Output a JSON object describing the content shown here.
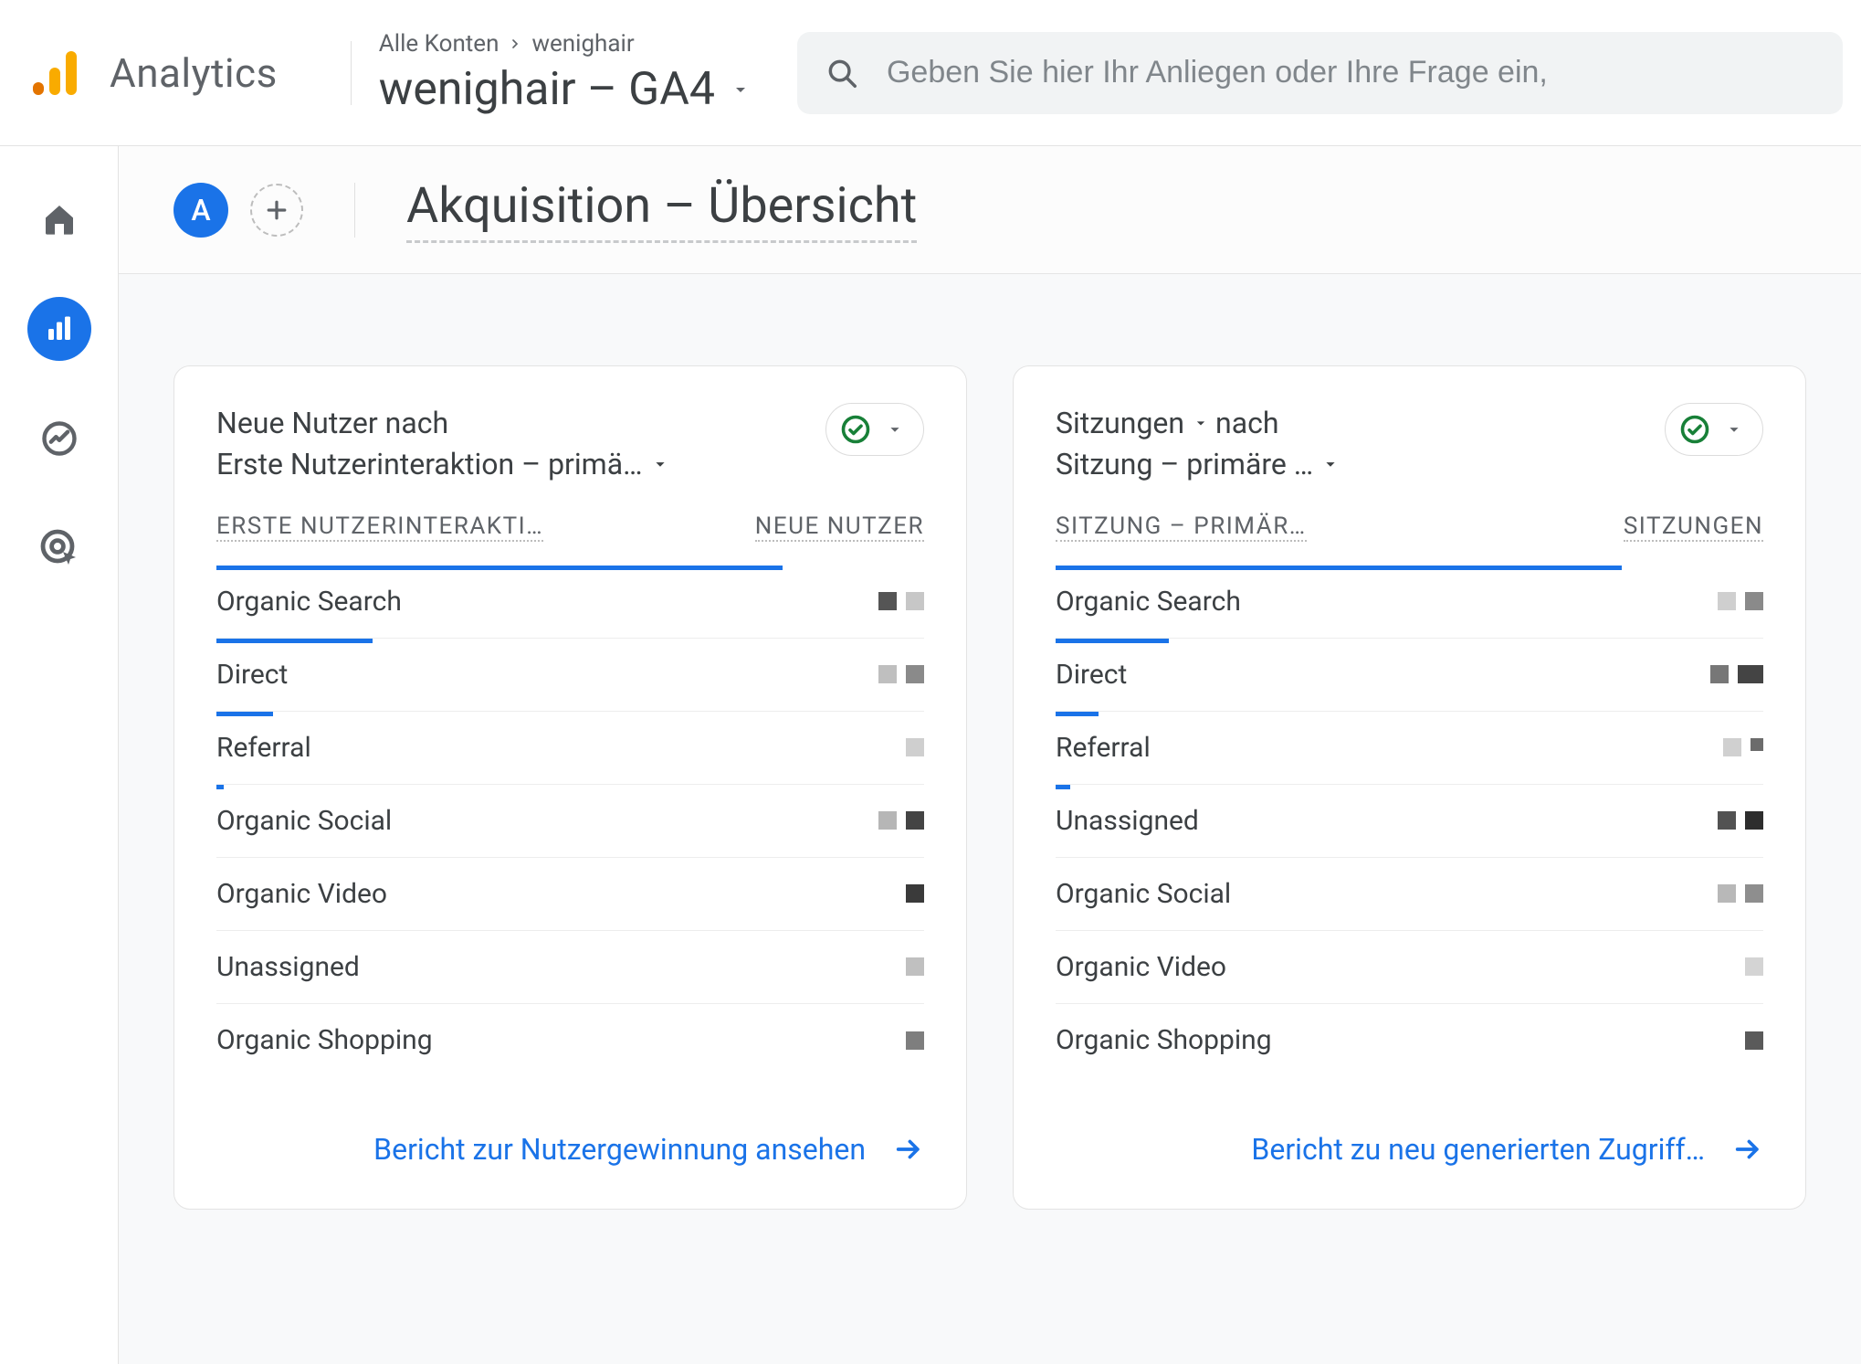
{
  "header": {
    "product": "Analytics",
    "breadcrumb_all": "Alle Konten",
    "breadcrumb_acc": "wenighair",
    "property": "wenighair  – GA4",
    "search_placeholder": "Geben Sie hier Ihr Anliegen oder Ihre Frage ein,"
  },
  "subheader": {
    "chip": "A",
    "page_title": "Akquisition – Übersicht"
  },
  "chart_data": [
    {
      "type": "bar",
      "title_line1": "Neue Nutzer nach",
      "title_line2": "Erste Nutzerinteraktion – primä…",
      "col_dim": "ERSTE NUTZERINTERAKTI…",
      "col_metric": "NEUE NUTZER",
      "categories": [
        "Organic Search",
        "Direct",
        "Referral",
        "Organic Social",
        "Organic Video",
        "Unassigned",
        "Organic Shopping"
      ],
      "bar_pct": [
        80,
        22,
        8,
        1,
        0,
        0,
        0
      ],
      "footer_link": "Bericht zur Nutzergewinnung ansehen"
    },
    {
      "type": "bar",
      "title_line1_a": "Sitzungen",
      "title_line1_b": " nach",
      "title_line2": "Sitzung – primäre …",
      "col_dim": "SITZUNG – PRIMÄR…",
      "col_metric": "SITZUNGEN",
      "categories": [
        "Organic Search",
        "Direct",
        "Referral",
        "Unassigned",
        "Organic Social",
        "Organic Video",
        "Organic Shopping"
      ],
      "bar_pct": [
        80,
        16,
        6,
        2,
        0,
        0,
        0
      ],
      "footer_link": "Bericht zu neu generierten Zugriff…"
    }
  ]
}
